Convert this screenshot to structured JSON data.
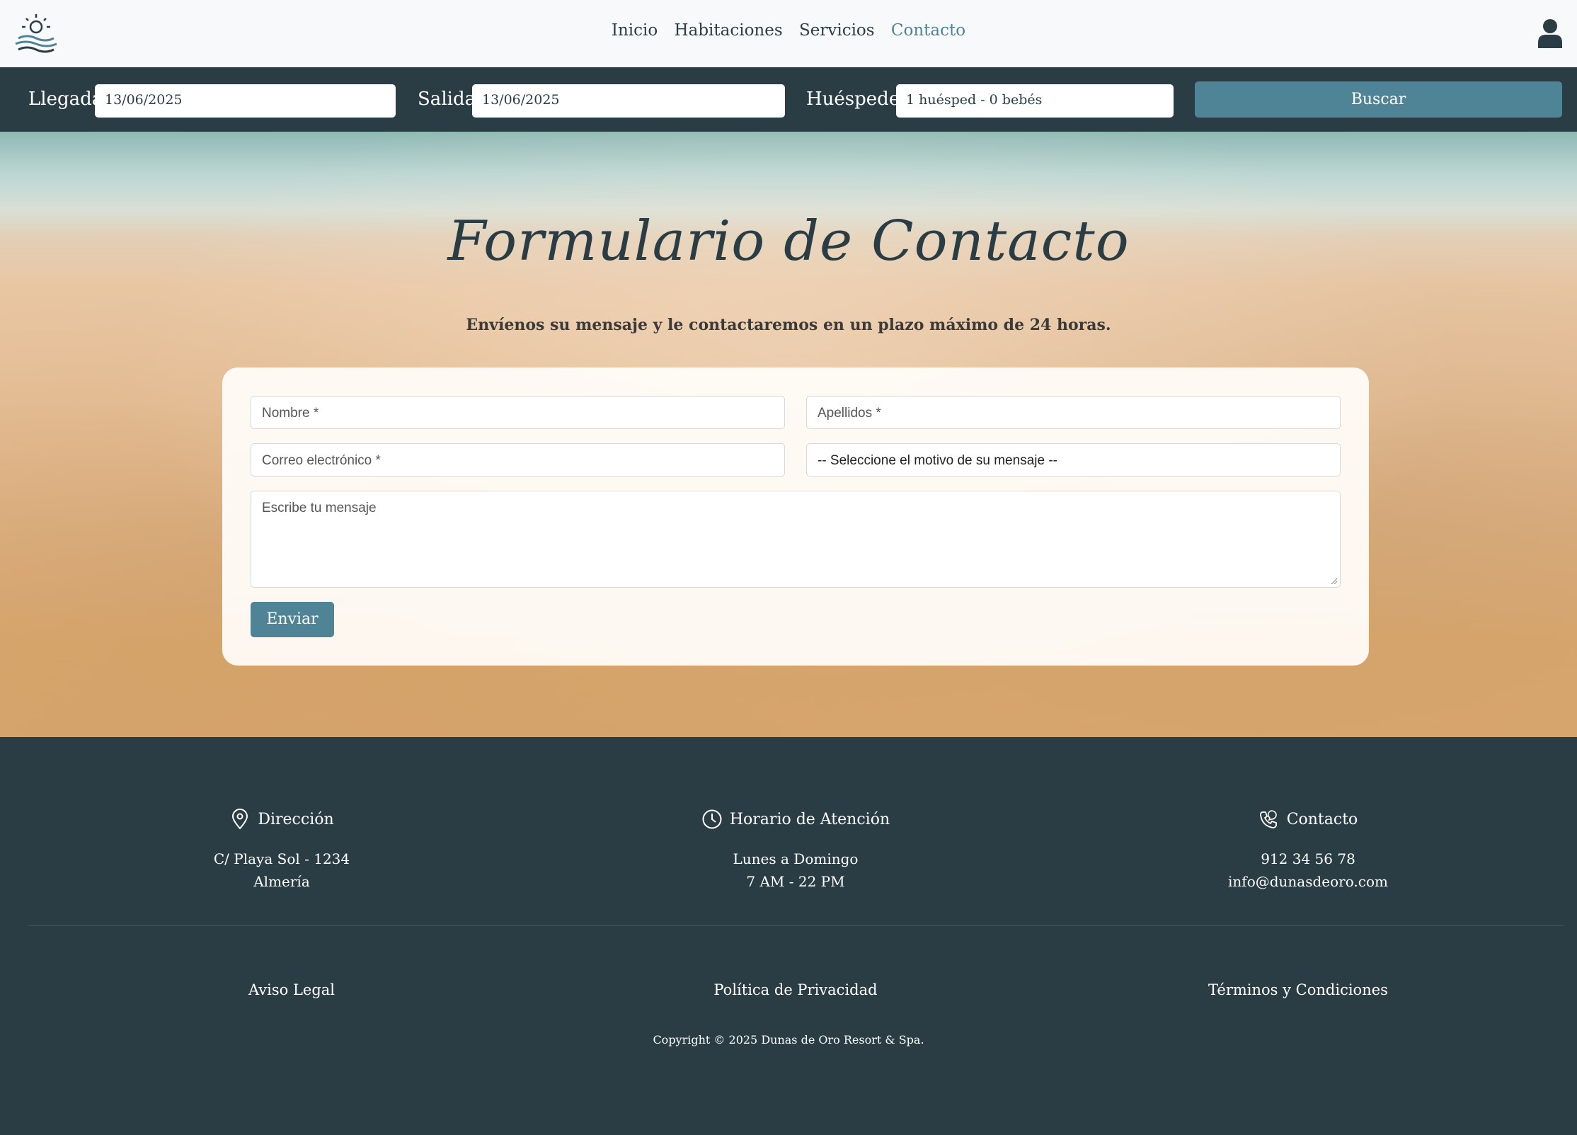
{
  "nav": {
    "links": [
      {
        "label": "Inicio"
      },
      {
        "label": "Habitaciones"
      },
      {
        "label": "Servicios"
      },
      {
        "label": "Contacto",
        "active": true
      }
    ]
  },
  "search": {
    "arrival_label": "Llegada",
    "arrival_value": "13/06/2025",
    "departure_label": "Salida",
    "departure_value": "13/06/2025",
    "guests_label": "Huéspedes",
    "guests_value": "1 huésped - 0 bebés",
    "button_label": "Buscar"
  },
  "hero": {
    "title": "Formulario de Contacto",
    "subtitle": "Envíenos su mensaje y le contactaremos en un plazo máximo de 24 horas."
  },
  "form": {
    "name_placeholder": "Nombre *",
    "surname_placeholder": "Apellidos *",
    "email_placeholder": "Correo electrónico *",
    "reason_selected": "-- Seleccione el motivo de su mensaje --",
    "message_placeholder": "Escribe tu mensaje",
    "submit_label": "Enviar"
  },
  "footer": {
    "address": {
      "title": "Dirección",
      "line1": "C/ Playa Sol - 1234",
      "line2": "Almería"
    },
    "hours": {
      "title": "Horario de Atención",
      "line1": "Lunes a Domingo",
      "line2": "7 AM - 22 PM"
    },
    "contact": {
      "title": "Contacto",
      "line1": "912 34 56 78",
      "line2": "info@dunasdeoro.com"
    },
    "links": {
      "legal": "Aviso Legal",
      "privacy": "Política de Privacidad",
      "terms": "Términos y Condiciones"
    },
    "copyright": "Copyright © 2025 Dunas de Oro Resort & Spa."
  },
  "colors": {
    "primary_dark": "#2a3d45",
    "accent": "#4f8497",
    "navbar_bg": "#f7f9fa"
  },
  "icons": [
    "sun-waves-logo-icon",
    "user-icon",
    "location-pin-icon",
    "clock-icon",
    "phone-chat-icon"
  ]
}
